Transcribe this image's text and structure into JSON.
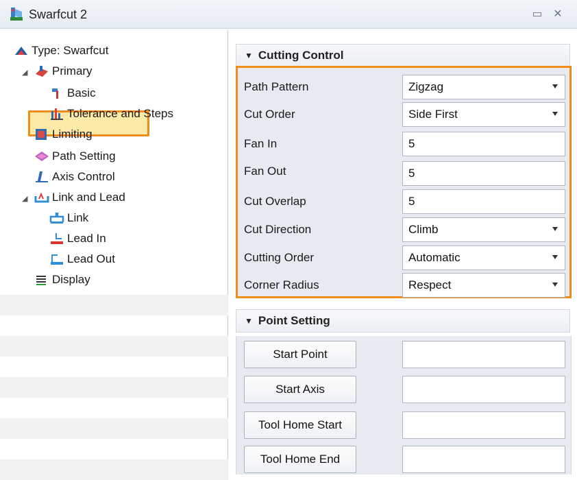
{
  "window": {
    "title": "Swarfcut 2",
    "pin_glyph": "▭",
    "close_glyph": "✕"
  },
  "tree": {
    "items": [
      {
        "label": "Type: Swarfcut",
        "icon": "operation-type-icon"
      },
      {
        "label": "Primary",
        "icon": "primary-icon"
      },
      {
        "label": "Basic",
        "icon": "basic-icon"
      },
      {
        "label": "Tolerance and Steps",
        "icon": "tolerance-icon"
      },
      {
        "label": "Limiting",
        "icon": "limiting-icon"
      },
      {
        "label": "Path Setting",
        "icon": "path-setting-icon"
      },
      {
        "label": "Axis Control",
        "icon": "axis-control-icon"
      },
      {
        "label": "Link and Lead",
        "icon": "link-lead-icon"
      },
      {
        "label": "Link",
        "icon": "link-icon"
      },
      {
        "label": "Lead In",
        "icon": "lead-in-icon"
      },
      {
        "label": "Lead Out",
        "icon": "lead-out-icon"
      },
      {
        "label": "Display",
        "icon": "display-icon"
      }
    ],
    "selected": "Path Setting"
  },
  "cutting_control": {
    "title": "Cutting Control",
    "rows": [
      {
        "label": "Path Pattern",
        "value": "Zigzag",
        "type": "dropdown"
      },
      {
        "label": "Cut Order",
        "value": "Side First",
        "type": "dropdown"
      },
      {
        "label": "Fan In",
        "value": "5",
        "type": "input"
      },
      {
        "label": "Fan Out",
        "value": "5",
        "type": "input"
      },
      {
        "label": "Cut Overlap",
        "value": "5",
        "type": "input"
      },
      {
        "label": "Cut Direction",
        "value": "Climb",
        "type": "dropdown"
      },
      {
        "label": "Cutting Order",
        "value": "Automatic",
        "type": "dropdown"
      },
      {
        "label": "Corner Radius",
        "value": "Respect",
        "type": "dropdown"
      }
    ]
  },
  "point_setting": {
    "title": "Point Setting",
    "buttons": [
      {
        "label": "Start Point",
        "value": ""
      },
      {
        "label": "Start Axis",
        "value": ""
      },
      {
        "label": "Tool Home Start",
        "value": ""
      },
      {
        "label": "Tool Home End",
        "value": ""
      }
    ]
  },
  "colors": {
    "highlight_border": "#f08c1a",
    "selected_fill": "#fde9a8",
    "panel_bg": "#e7ebf1"
  }
}
